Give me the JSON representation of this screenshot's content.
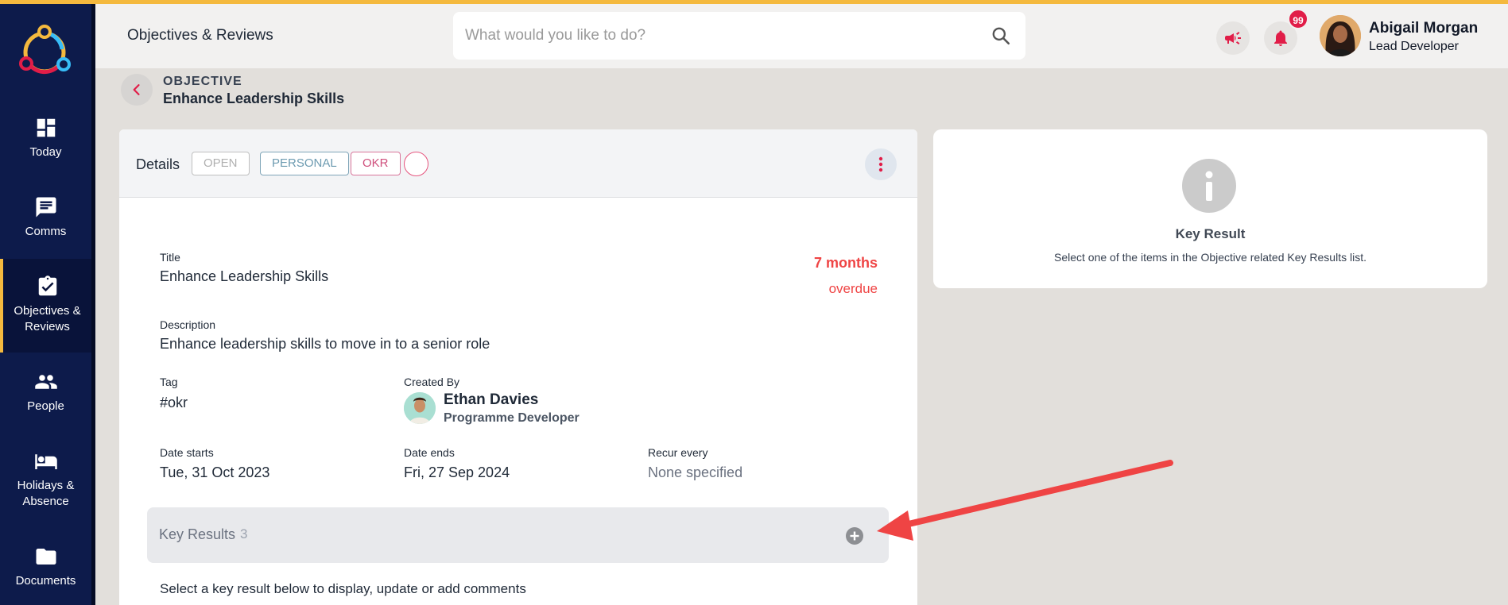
{
  "sidebar": {
    "items": [
      {
        "label": "Today",
        "icon": "dashboard-icon"
      },
      {
        "label": "Comms",
        "icon": "chat-icon"
      },
      {
        "label": "Objectives &",
        "label2": "Reviews",
        "icon": "clipboard-check-icon"
      },
      {
        "label": "People",
        "icon": "people-icon"
      },
      {
        "label": "Holidays &",
        "label2": "Absence",
        "icon": "bed-icon"
      },
      {
        "label": "Documents",
        "icon": "folder-icon"
      }
    ]
  },
  "header": {
    "title": "Objectives & Reviews",
    "search_placeholder": "What would you like to do?",
    "notification_count": "99",
    "user_name": "Abigail Morgan",
    "user_role": "Lead Developer"
  },
  "breadcrumb": {
    "label": "OBJECTIVE",
    "title": "Enhance Leadership Skills"
  },
  "card": {
    "tab_label": "Details",
    "pills": [
      "OPEN",
      "PERSONAL",
      "OKR"
    ],
    "overdue_value": "7 months",
    "overdue_label": "overdue",
    "fields": {
      "title_label": "Title",
      "title_value": "Enhance Leadership Skills",
      "description_label": "Description",
      "description_value": "Enhance leadership skills to move in to a senior role",
      "tag_label": "Tag",
      "tag_value": "#okr",
      "created_by_label": "Created By",
      "creator_name": "Ethan Davies",
      "creator_role": "Programme Developer",
      "date_starts_label": "Date starts",
      "date_starts_value": "Tue, 31 Oct 2023",
      "date_ends_label": "Date ends",
      "date_ends_value": "Fri, 27 Sep 2024",
      "recur_label": "Recur every",
      "recur_value": "None specified"
    },
    "key_results": {
      "label": "Key Results",
      "count": "3",
      "hint": "Select a key result below to display, update or add comments"
    }
  },
  "side_panel": {
    "title": "Key Result",
    "text": "Select one of the items in the Objective related Key Results list."
  },
  "colors": {
    "sidebar": "#0d1b4b",
    "accent_yellow": "#f4b93e",
    "pink": "#e11d48",
    "overdue_red": "#ef4444",
    "annotation_arrow": "#ef4444"
  }
}
